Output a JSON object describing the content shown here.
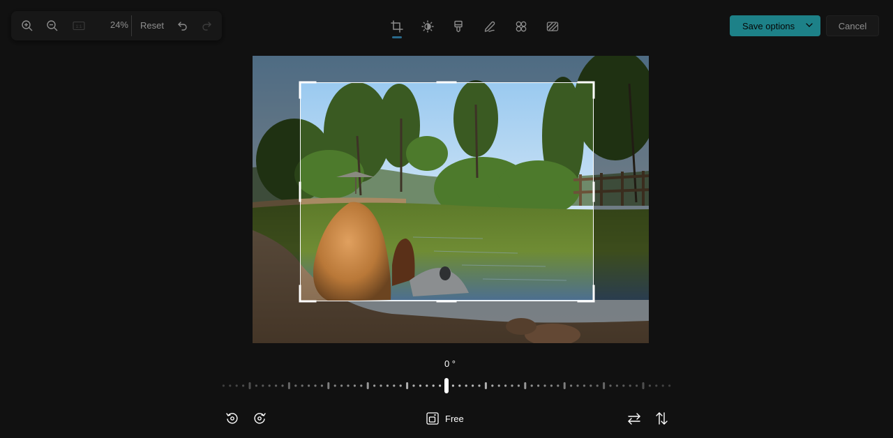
{
  "zoom_toolbar": {
    "zoom_level": "24%",
    "reset_label": "Reset",
    "actual_size_label": "1:1"
  },
  "tool_tabs": [
    {
      "name": "crop",
      "icon": "crop-icon",
      "active": true
    },
    {
      "name": "adjustment",
      "icon": "brightness-icon",
      "active": false
    },
    {
      "name": "filter",
      "icon": "filter-icon",
      "active": false
    },
    {
      "name": "markup",
      "icon": "markup-pen-icon",
      "active": false
    },
    {
      "name": "retouch",
      "icon": "retouch-icon",
      "active": false
    },
    {
      "name": "background",
      "icon": "background-icon",
      "active": false
    }
  ],
  "header": {
    "save_label": "Save options",
    "cancel_label": "Cancel"
  },
  "rotation": {
    "angle_label": "0 °",
    "angle_value": 0
  },
  "bottom_bar": {
    "aspect_ratio_label": "Free"
  },
  "colors": {
    "background": "#202020",
    "accent": "#35ecf7",
    "indicator": "#4cc2ff"
  }
}
